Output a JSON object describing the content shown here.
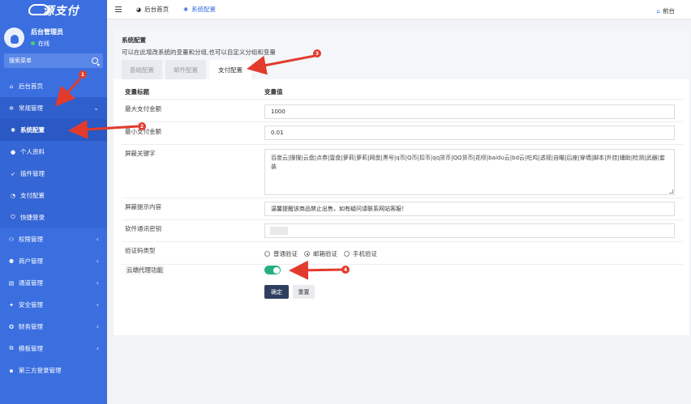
{
  "brand": {
    "logo_text": "源支付"
  },
  "user": {
    "name": "后台管理员",
    "status": "在线"
  },
  "search": {
    "label": "搜索菜单"
  },
  "sidebar": {
    "items": [
      {
        "label": "后台首页",
        "icon": "home-icon"
      },
      {
        "label": "常规管理",
        "icon": "gears-icon",
        "arrow": "⌄"
      },
      {
        "label": "系统配置",
        "icon": "gear-icon"
      },
      {
        "label": "个人资料",
        "icon": "user-icon"
      },
      {
        "label": "插件管理",
        "icon": "rocket-icon"
      },
      {
        "label": "支付配置",
        "icon": "clock-icon"
      },
      {
        "label": "快捷登录",
        "icon": "power-icon"
      },
      {
        "label": "权限管理",
        "icon": "group-icon",
        "arrow": "‹"
      },
      {
        "label": "商户管理",
        "icon": "users-icon",
        "arrow": "‹"
      },
      {
        "label": "通道管理",
        "icon": "list-icon",
        "arrow": "‹"
      },
      {
        "label": "安全管理",
        "icon": "shield-icon",
        "arrow": "‹"
      },
      {
        "label": "财务管理",
        "icon": "money-icon",
        "arrow": "‹"
      },
      {
        "label": "模板管理",
        "icon": "template-icon",
        "arrow": "‹"
      },
      {
        "label": "第三方登录管理",
        "icon": "link-icon"
      }
    ]
  },
  "topbar": {
    "tabs": [
      {
        "label": "后台首页",
        "icon": "dashboard-icon"
      },
      {
        "label": "系统配置",
        "icon": "gear-icon"
      }
    ],
    "front_link": "前台"
  },
  "panel": {
    "title": "系统配置",
    "description": "可以在此增改系统的变量和分组,也可以自定义分组和变量",
    "tabs": [
      "基础配置",
      "邮件配置",
      "支付配置"
    ]
  },
  "table": {
    "col_title": "变量标题",
    "col_value": "变量值",
    "rows": {
      "max_amount": {
        "label": "最大支付金额",
        "value": "1000"
      },
      "min_amount": {
        "label": "最小支付金额",
        "value": "0.01"
      },
      "keywords": {
        "label": "屏蔽关键字",
        "value": "百度云|搜搜|云盘|点券|壹盘|萝莉|萝莉|网盘|黑号|q币|Q币|扣币|qq货币|QQ货币|花呗|baidu云|bd云|吃鸡|透视|自瞄|后座|穿墙|脚本|外挂|辅助|检测|武器|套装"
      },
      "notice": {
        "label": "屏蔽提示内容",
        "value": "温馨提醒该商品禁止出售，如有疑问请联系网站客服！"
      },
      "secret": {
        "label": "软件通讯密钥",
        "value": ""
      },
      "captcha": {
        "label": "验证码类型",
        "options": [
          "普通验证",
          "邮箱验证",
          "手机验证"
        ],
        "selected": "邮箱验证"
      },
      "proxy": {
        "label": "云端代理功能",
        "enabled": true
      }
    },
    "submit": "确定",
    "reset": "重置"
  },
  "annotations": [
    "1",
    "2",
    "3",
    "4"
  ],
  "colors": {
    "sidebar": "#3b6fe0",
    "accent": "#3b6fe0",
    "toggle": "#26b07f",
    "annotation": "#e23b2d"
  }
}
